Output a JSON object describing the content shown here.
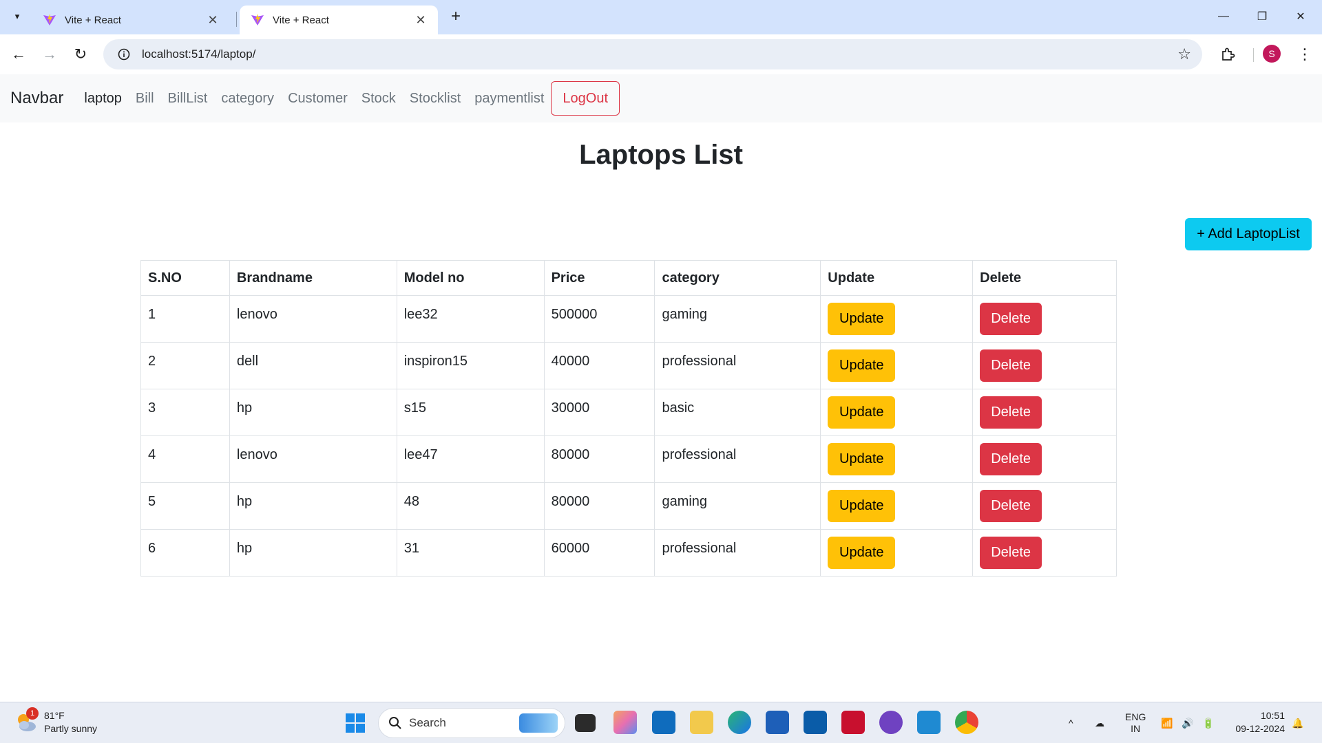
{
  "browser": {
    "tabs": [
      {
        "title": "Vite + React",
        "active": false
      },
      {
        "title": "Vite + React",
        "active": true
      }
    ],
    "url": "localhost:5174/laptop/",
    "profile_initial": "S"
  },
  "navbar": {
    "brand": "Navbar",
    "links": [
      {
        "label": "laptop",
        "active": true
      },
      {
        "label": "Bill"
      },
      {
        "label": "BillList"
      },
      {
        "label": "category"
      },
      {
        "label": "Customer"
      },
      {
        "label": "Stock"
      },
      {
        "label": "Stocklist"
      },
      {
        "label": "paymentlist"
      }
    ],
    "logout_label": "LogOut"
  },
  "page": {
    "title": "Laptops List",
    "add_button_label": "+ Add LaptopList"
  },
  "table": {
    "headers": [
      "S.NO",
      "Brandname",
      "Model no",
      "Price",
      "category",
      "Update",
      "Delete"
    ],
    "rows": [
      {
        "sno": "1",
        "brand": "lenovo",
        "model": "lee32",
        "price": "500000",
        "category": "gaming"
      },
      {
        "sno": "2",
        "brand": "dell",
        "model": "inspiron15",
        "price": "40000",
        "category": "professional"
      },
      {
        "sno": "3",
        "brand": "hp",
        "model": "s15",
        "price": "30000",
        "category": "basic"
      },
      {
        "sno": "4",
        "brand": "lenovo",
        "model": "lee47",
        "price": "80000",
        "category": "professional"
      },
      {
        "sno": "5",
        "brand": "hp",
        "model": "48",
        "price": "80000",
        "category": "gaming"
      },
      {
        "sno": "6",
        "brand": "hp",
        "model": "31",
        "price": "60000",
        "category": "professional"
      }
    ],
    "update_label": "Update",
    "delete_label": "Delete"
  },
  "taskbar": {
    "weather_temp": "81°F",
    "weather_desc": "Partly sunny",
    "weather_badge": "1",
    "search_placeholder": "Search",
    "lang_top": "ENG",
    "lang_bottom": "IN",
    "time": "10:51",
    "date": "09-12-2024"
  },
  "colors": {
    "accent_info": "#0dcaf0",
    "warning": "#ffc107",
    "danger": "#dc3545",
    "tabstrip": "#d3e3fd"
  }
}
